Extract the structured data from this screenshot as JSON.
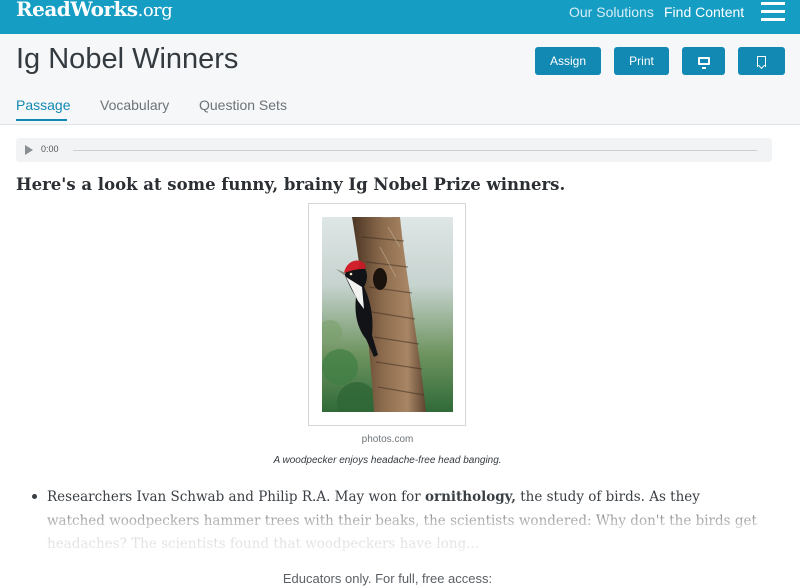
{
  "topbar": {
    "logo_main": "ReadWorks",
    "logo_tld": ".org",
    "nav": [
      "Our Solutions",
      "Find Content"
    ],
    "menu_icon": "hamburger-menu-icon",
    "color": "#169dc3"
  },
  "header": {
    "title": "Ig Nobel Winners",
    "buttons": {
      "assign": "Assign",
      "print": "Print"
    },
    "icons": {
      "present": "monitor-icon",
      "bookmark": "bookmark-icon"
    },
    "tabs": [
      "Passage",
      "Vocabulary",
      "Question Sets"
    ],
    "active_tab": "Passage",
    "accent": "#1189b3"
  },
  "audio": {
    "time": "0:00",
    "icon": "play-icon"
  },
  "article": {
    "headline": "Here's a look at some funny, brainy Ig Nobel Prize winners.",
    "image_credit": "photos.com",
    "image_caption": "A woodpecker enjoys headache-free head banging.",
    "para_start": "Researchers Ivan Schwab and Philip R.A. May won for ",
    "para_bold": "ornithology,",
    "para_rest": " the study of birds. As they watched woodpeckers hammer trees with their beaks, the scientists wondered: Why don't the birds get headaches? The scientists found that woodpeckers have long..."
  },
  "access_notice": "Educators only. For full, free access:"
}
